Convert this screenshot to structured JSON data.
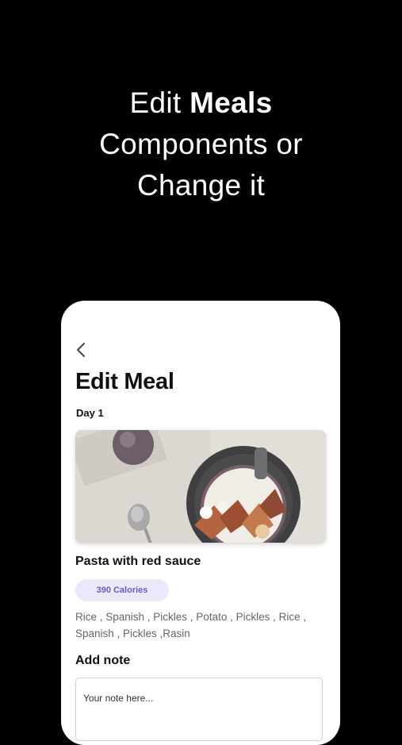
{
  "promo": {
    "line1_prefix": "Edit",
    "line1_bold": "Meals",
    "line2": "Components or",
    "line3": "Change it"
  },
  "screen": {
    "title": "Edit Meal",
    "day_label": "Day 1",
    "meal": {
      "name": "Pasta with red sauce",
      "calories": "390 Calories",
      "ingredients": "Rice , Spanish , Pickles , Potato , Pickles , Rice , Spanish , Pickles ,Rasin"
    },
    "note": {
      "label": "Add note",
      "placeholder": "Your note here..."
    }
  },
  "colors": {
    "background": "#000000",
    "card": "#ffffff",
    "calorie_badge_bg": "#ece8fb",
    "calorie_badge_text": "#6a5cc4"
  },
  "icons": {
    "back": "chevron-left-icon"
  }
}
